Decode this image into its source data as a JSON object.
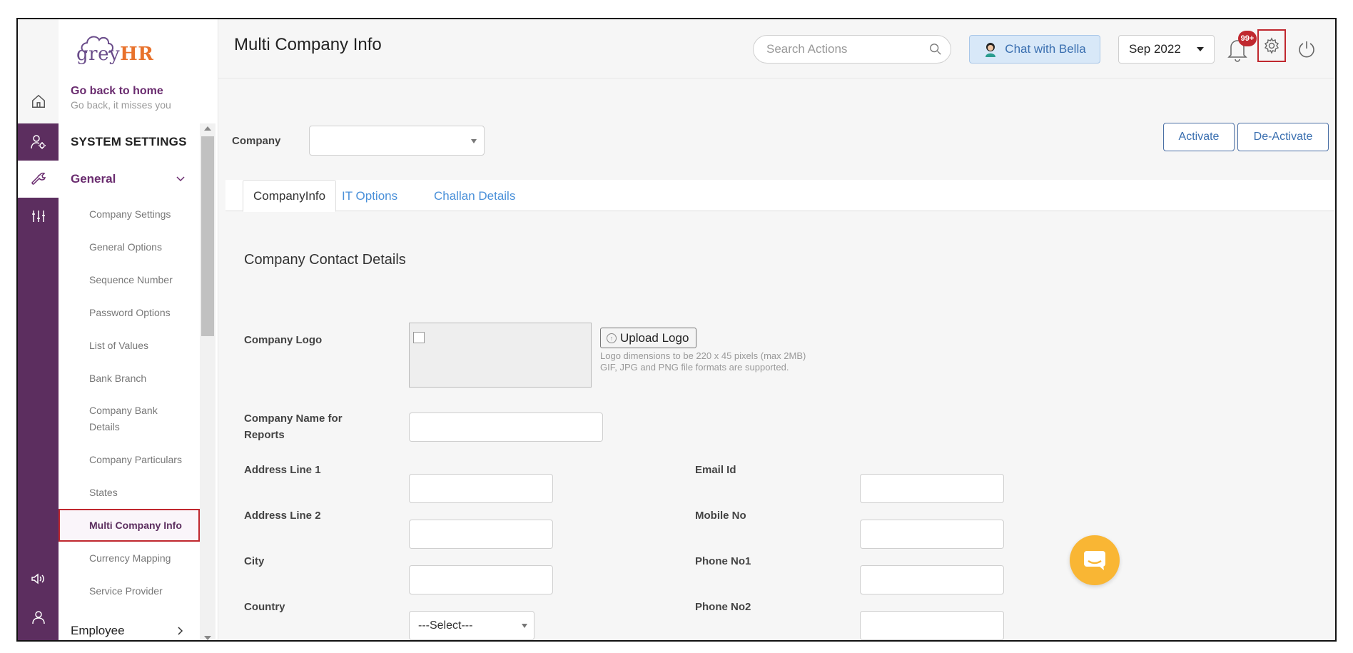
{
  "app": {
    "brand_grey": "grey",
    "brand_hr": "HR"
  },
  "colors": {
    "rail": "#5c2e5f",
    "accent": "#6a2c6f",
    "link": "#4a90d9",
    "highlight": "#c0282f",
    "chat_fab": "#f9b634"
  },
  "nav_home": {
    "title": "Go back to home",
    "subtitle": "Go back, it misses you"
  },
  "rail_icons": [
    "home-icon",
    "user-settings-icon",
    "wrench-icon",
    "sliders-icon",
    "megaphone-icon",
    "user-icon"
  ],
  "sidebar": {
    "section": "SYSTEM SETTINGS",
    "group": "General",
    "items": [
      "Company Settings",
      "General Options",
      "Sequence Number",
      "Password Options",
      "List of Values",
      "Bank Branch",
      "Company Bank Details",
      "Company Particulars",
      "States",
      "Multi Company Info",
      "Currency Mapping",
      "Service Provider"
    ],
    "active_item": "Multi Company Info",
    "next_group": "Employee"
  },
  "header": {
    "title": "Multi Company Info",
    "search_placeholder": "Search Actions",
    "chat_label": "Chat with Bella",
    "month": "Sep 2022",
    "notification_badge": "99+"
  },
  "main": {
    "company_label": "Company",
    "company_value": "",
    "activate_label": "Activate",
    "deactivate_label": "De-Activate",
    "tabs": [
      "CompanyInfo",
      "IT Options",
      "Challan Details"
    ],
    "active_tab": "CompanyInfo",
    "section_title": "Company Contact Details",
    "logo_label": "Company Logo",
    "upload_label": "Upload Logo",
    "logo_hint_1": "Logo dimensions to be 220 x 45 pixels (max 2MB)",
    "logo_hint_2": "GIF, JPG and PNG file formats are supported.",
    "fields": {
      "company_name": "Company Name for Reports",
      "address1": "Address Line 1",
      "address2": "Address Line 2",
      "city": "City",
      "country": "Country",
      "email": "Email Id",
      "mobile": "Mobile No",
      "phone1": "Phone No1",
      "phone2": "Phone No2"
    },
    "country_value": "---Select---"
  }
}
